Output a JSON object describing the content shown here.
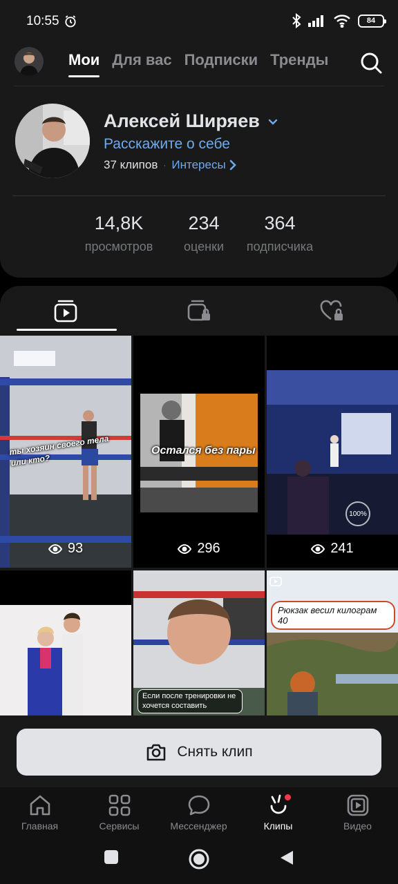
{
  "status": {
    "time": "10:55",
    "battery": "84"
  },
  "top_nav": {
    "tabs": [
      "Мои",
      "Для вас",
      "Подписки",
      "Тренды"
    ],
    "active_tab": "Мои"
  },
  "profile": {
    "name": "Алексей Ширяев",
    "bio_placeholder": "Расскажите о себе",
    "clips_count": "37 клипов",
    "interests_label": "Интересы"
  },
  "stats": [
    {
      "value": "14,8K",
      "label": "просмотров"
    },
    {
      "value": "234",
      "label": "оценки"
    },
    {
      "value": "364",
      "label": "подписчика"
    }
  ],
  "clips": [
    {
      "views": "93",
      "caption": "ты хозяин своего тела или кто?"
    },
    {
      "views": "296",
      "caption": "Остался без пары"
    },
    {
      "views": "241",
      "caption": "100%"
    },
    {
      "views": "",
      "caption": ""
    },
    {
      "views": "",
      "caption": "Если после тренировки не хочется составить"
    },
    {
      "views": "",
      "caption": "Рюкзак весил килограм 40"
    }
  ],
  "record_button": "Снять клип",
  "tabbar": [
    {
      "label": "Главная",
      "icon": "home-icon"
    },
    {
      "label": "Сервисы",
      "icon": "services-icon"
    },
    {
      "label": "Мессенджер",
      "icon": "messenger-icon"
    },
    {
      "label": "Клипы",
      "icon": "clips-icon"
    },
    {
      "label": "Видео",
      "icon": "video-icon"
    }
  ],
  "colors": {
    "background": "#19191a",
    "accent_link": "#71aaeb",
    "text_primary": "#e1e3e6",
    "text_secondary": "#76787a",
    "notification_dot": "#ff3347"
  }
}
